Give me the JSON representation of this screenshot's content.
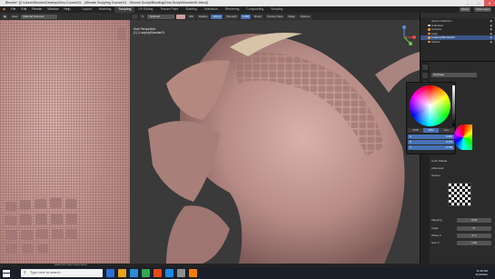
{
  "titlebar": {
    "title": "Blender* [C:\\Users\\Wonder\\Desktop\\Dino-Course\\01 - Ultimate Sculpting Course\\01 - Second Sculpt\\Blocking\\Dino-Sculpt\\Monster01.blend]",
    "min": "–",
    "max": "□",
    "close": "✕"
  },
  "menubar": {
    "menus": [
      "File",
      "Edit",
      "Render",
      "Window",
      "Help"
    ],
    "workspaces": [
      "Layout",
      "Modeling",
      "Sculpting",
      "UV Editing",
      "Texture Paint",
      "Shading",
      "Animation",
      "Rendering",
      "Compositing",
      "Scripting"
    ],
    "active_workspace": "Sculpting",
    "scene": "Scene",
    "view_layer": "View Layer"
  },
  "imgheader": {
    "mode": "View",
    "image_name": "Material Textured"
  },
  "toolheader": {
    "brush": "TexDraw",
    "radius_label": "Radius",
    "radius_value": "100 px",
    "strength_label": "Strength",
    "strength_value": "1.000",
    "blend": "Mix",
    "menus": [
      "Brush",
      "Texture Slots",
      "Mask",
      "Options"
    ]
  },
  "viewport": {
    "info_line1": "User Perspective",
    "info_line2": "(1) | Lowpoly/Monster01"
  },
  "outliner": {
    "items": [
      {
        "label": "Scene Collection",
        "selected": false
      },
      {
        "label": "Collection",
        "selected": false
      },
      {
        "label": "Camera",
        "selected": false
      },
      {
        "label": "Light",
        "selected": false
      },
      {
        "label": "Lowpoly/Monster01",
        "selected": true
      },
      {
        "label": "Sphere",
        "selected": false
      }
    ]
  },
  "props": {
    "brush_name": "TexDraw",
    "fields": [
      {
        "label": "Radius",
        "value": "100 px"
      },
      {
        "label": "Strength",
        "value": "1.000"
      }
    ],
    "sections": [
      "Color Palette",
      "Advanced",
      "Texture"
    ],
    "mapping_label": "Mapping",
    "mapping_value": "Tiled",
    "angle_label": "Angle",
    "angle_value": "0°",
    "offset_label": "Offset X",
    "offset_value": "0 m",
    "size_label": "Size X",
    "size_value": "1.00"
  },
  "picker": {
    "tabs": [
      "RGB",
      "HSV",
      "Hex"
    ],
    "active_tab": "HSV",
    "h_label": "H",
    "h_value": "0.000",
    "s_label": "S",
    "s_value": "0.172",
    "v_label": "V",
    "v_value": "0.769"
  },
  "statusbar": {
    "text": "Select          Pan View          Context Menu"
  },
  "taskbar": {
    "search_placeholder": "Type here to search",
    "time": "11:28 AM",
    "date": "6/13/2021",
    "app_colors": [
      "#2b6fd6",
      "#e8a21a",
      "#2a8cd6",
      "#34a853",
      "#e64a19",
      "#1e88e5",
      "#8e8e8e",
      "#f57c00"
    ]
  },
  "colors": {
    "accent": "#4772b3",
    "selection": "#3b5689",
    "skin": "#c8a19a"
  }
}
